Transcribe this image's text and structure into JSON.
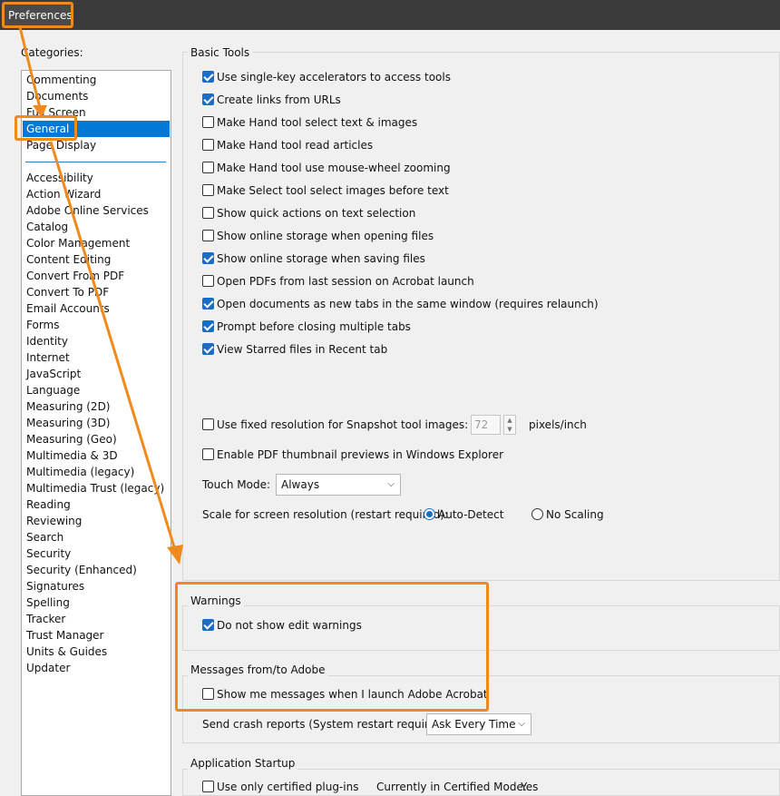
{
  "window": {
    "title": "Preferences"
  },
  "categories": {
    "label": "Categories:",
    "top_items": [
      "Commenting",
      "Documents",
      "Full Screen",
      "General",
      "Page Display"
    ],
    "items": [
      "Accessibility",
      "Action Wizard",
      "Adobe Online Services",
      "Catalog",
      "Color Management",
      "Content Editing",
      "Convert From PDF",
      "Convert To PDF",
      "Email Accounts",
      "Forms",
      "Identity",
      "Internet",
      "JavaScript",
      "Language",
      "Measuring (2D)",
      "Measuring (3D)",
      "Measuring (Geo)",
      "Multimedia & 3D",
      "Multimedia (legacy)",
      "Multimedia Trust (legacy)",
      "Reading",
      "Reviewing",
      "Search",
      "Security",
      "Security (Enhanced)",
      "Signatures",
      "Spelling",
      "Tracker",
      "Trust Manager",
      "Units & Guides",
      "Updater"
    ],
    "selected": "General"
  },
  "basic_tools": {
    "legend": "Basic Tools",
    "options": [
      {
        "label": "Use single-key accelerators to access tools",
        "checked": true
      },
      {
        "label": "Create links from URLs",
        "checked": true
      },
      {
        "label": "Make Hand tool select text & images",
        "checked": false
      },
      {
        "label": "Make Hand tool read articles",
        "checked": false
      },
      {
        "label": "Make Hand tool use mouse-wheel zooming",
        "checked": false
      },
      {
        "label": "Make Select tool select images before text",
        "checked": false
      },
      {
        "label": "Show quick actions on text selection",
        "checked": false
      },
      {
        "label": "Show online storage when opening files",
        "checked": false
      },
      {
        "label": "Show online storage when saving files",
        "checked": true
      },
      {
        "label": "Open PDFs from last session on Acrobat launch",
        "checked": false
      },
      {
        "label": "Open documents as new tabs in the same window (requires relaunch)",
        "checked": true
      },
      {
        "label": "Prompt before closing multiple tabs",
        "checked": true
      },
      {
        "label": "View Starred files in Recent tab",
        "checked": true
      }
    ],
    "snapshot": {
      "label": "Use fixed resolution for Snapshot tool images:",
      "checked": false,
      "value": "72",
      "unit": "pixels/inch"
    },
    "thumbnail": {
      "label": "Enable PDF thumbnail previews in Windows Explorer",
      "checked": false
    },
    "touch_mode": {
      "label": "Touch Mode:",
      "value": "Always"
    },
    "scale": {
      "label": "Scale for screen resolution (restart required):",
      "option1": "Auto-Detect",
      "option2": "No Scaling",
      "selected": "Auto-Detect"
    }
  },
  "warnings": {
    "legend": "Warnings",
    "option": {
      "label": "Do not show edit warnings",
      "checked": true
    }
  },
  "messages": {
    "legend": "Messages from/to Adobe",
    "option": {
      "label": "Show me messages when I launch Adobe Acrobat",
      "checked": false
    },
    "crash": {
      "label": "Send crash reports (System restart required):",
      "value": "Ask Every Time"
    }
  },
  "startup": {
    "legend": "Application Startup",
    "plugins": {
      "label": "Use only certified plug-ins",
      "checked": false
    },
    "mode_label": "Currently in Certified Mode:",
    "mode_value": "Yes"
  },
  "colors": {
    "highlight": "#f08a1c",
    "selection": "#0078d7",
    "checkbox": "#1a6dc7"
  }
}
